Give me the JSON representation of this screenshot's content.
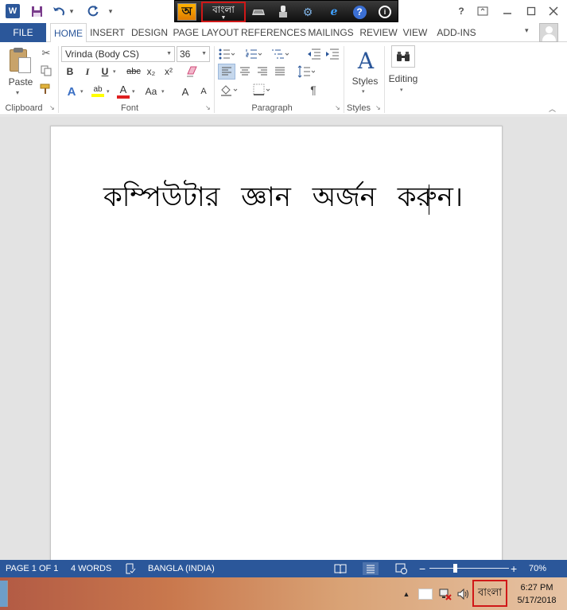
{
  "app": {
    "icon_letter": "W",
    "qat": {
      "save_icon": "save-icon",
      "undo_icon": "undo-icon",
      "redo_icon": "redo-icon"
    }
  },
  "avro": {
    "logo_glyph": "অ",
    "language": "বাংলা",
    "icons": [
      "keyboard-icon",
      "layout-icon",
      "settings-icon",
      "web-icon",
      "help-icon",
      "exit-icon"
    ],
    "web_glyph": "e",
    "help_glyph": "?",
    "exit_glyph": "i"
  },
  "window": {
    "help_glyph": "?"
  },
  "ribbon": {
    "file_label": "FILE",
    "tabs": [
      "HOME",
      "INSERT",
      "DESIGN",
      "PAGE LAYOUT",
      "REFERENCES",
      "MAILINGS",
      "REVIEW",
      "VIEW",
      "ADD-INS"
    ],
    "active_tab": "HOME",
    "clipboard": {
      "paste_label": "Paste",
      "group_label": "Clipboard"
    },
    "font": {
      "name": "Vrinda (Body CS)",
      "size": "36",
      "bold": "B",
      "italic": "I",
      "underline": "U",
      "strike": "abc",
      "subscript": "x₂",
      "superscript": "x²",
      "text_effects": "A",
      "highlight": "ab",
      "font_color": "A",
      "change_case": "Aa",
      "grow_font": "A",
      "shrink_font": "A",
      "group_label": "Font"
    },
    "paragraph": {
      "group_label": "Paragraph",
      "pilcrow": "¶",
      "active_alignment": "left"
    },
    "styles": {
      "label": "Styles",
      "icon_glyph": "A",
      "group_label": "Styles"
    },
    "editing": {
      "label": "Editing"
    }
  },
  "document": {
    "text": "কম্পিউটার জ্ঞান অর্জন করুন।"
  },
  "status": {
    "page": "PAGE 1 OF 1",
    "words": "4 WORDS",
    "language": "BANGLA (INDIA)",
    "zoom": "70%",
    "zoom_fraction": 0.32
  },
  "taskbar": {
    "language": "বাংলা",
    "time": "6:27 PM",
    "date": "5/17/2018"
  },
  "colors": {
    "word_blue": "#2b579a",
    "highlight_red": "#d01818",
    "avro_bar": "#1a1a1a"
  }
}
